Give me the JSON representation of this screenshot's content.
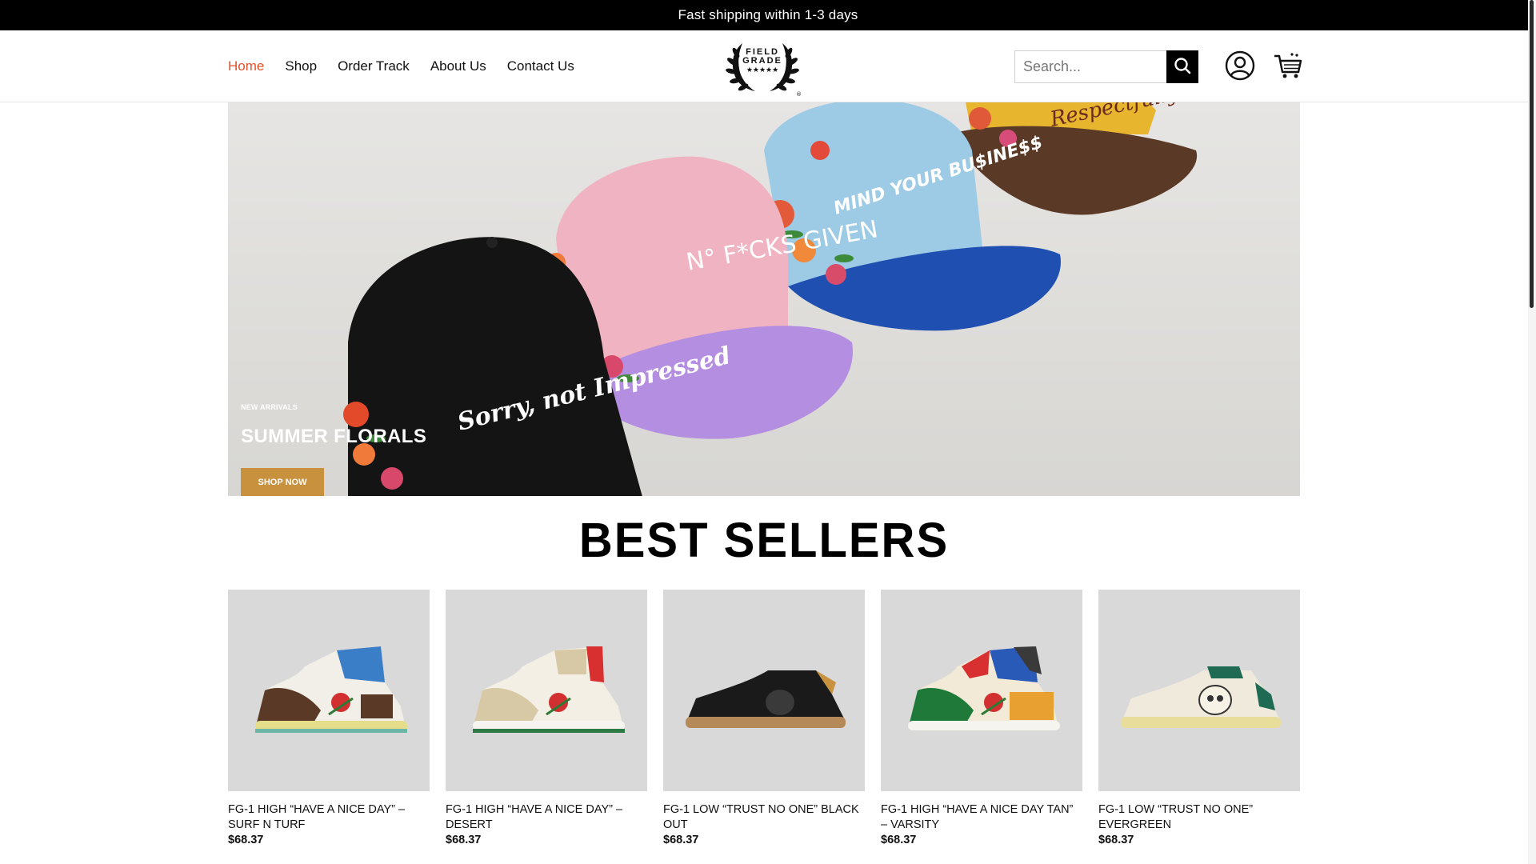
{
  "announcement": "Fast shipping within 1-3 days",
  "nav": {
    "items": [
      "Home",
      "Shop",
      "Order Track",
      "About Us",
      "Contact Us"
    ],
    "active": "Home"
  },
  "brand": {
    "logo_line1": "FIELD",
    "logo_line2": "GRADE"
  },
  "search": {
    "placeholder": "Search..."
  },
  "icons": {
    "search": "search-icon",
    "account": "user-icon",
    "cart": "cart-icon"
  },
  "hero": {
    "kicker": "NEW ARRIVALS",
    "title": "SUMMER FLORALS",
    "cta": "SHOP NOW",
    "cap_texts": [
      "Sorry, not Impressed",
      "N° F*CKS GIVEN",
      "MIND YOUR BU$INE$$",
      "Respectfully"
    ]
  },
  "best_sellers": {
    "title": "BEST SELLERS",
    "products": [
      {
        "name": "FG-1 HIGH “HAVE A NICE DAY” – SURF N TURF",
        "price": "$68.37"
      },
      {
        "name": "FG-1 HIGH “HAVE A NICE DAY” – DESERT",
        "price": "$68.37"
      },
      {
        "name": "FG-1 LOW “TRUST NO ONE” BLACK OUT",
        "price": "$68.37"
      },
      {
        "name": "FG-1 HIGH “HAVE A NICE DAY TAN” – VARSITY",
        "price": "$68.37"
      },
      {
        "name": "FG-1 LOW “TRUST NO ONE” EVERGREEN",
        "price": "$68.37"
      }
    ]
  },
  "colors": {
    "accent": "#e0512a",
    "cta": "#c8913e",
    "topbar": "#000000"
  }
}
